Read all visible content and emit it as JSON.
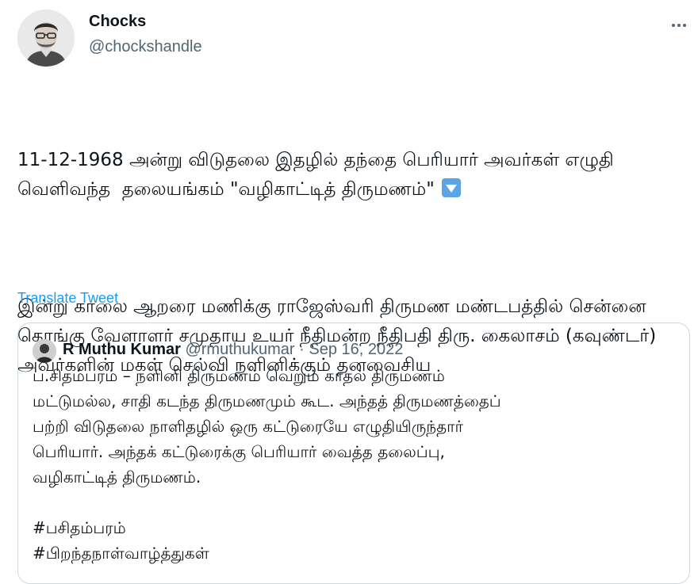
{
  "author": {
    "name": "Chocks",
    "handle": "@chockshandle",
    "avatar_icon": "person-portrait-icon"
  },
  "tweet": {
    "line1": "11-12-1968 அன்று விடுதலை இதழில் தந்தை பெரியார் அவர்கள் எழுதி வெளிவந்த  தலையங்கம் \"வழிகாட்டித் திருமணம்\"",
    "emoji": "down-arrow-button-icon",
    "para2": "இன்று காலை ஆறரை மணிக்கு ராஜேஸ்வரி திருமண மண்டபத்தில் சென்னை கொங்கு வேளாளர் சமுதாய உயர் நீதிமன்ற நீதிபதி திரு. கைலாசம் (கவுண்டர்) அவர்களின் மகள் செல்வி நளினிக்கும் தனவைசிய"
  },
  "translate_label": "Translate Tweet",
  "more_icon": "ellipsis-icon",
  "quote": {
    "name": "R Muthu Kumar",
    "handle": "@rmuthukumar",
    "separator": "·",
    "date": "Sep 16, 2022",
    "lines": [
      "ப.சிதம்பரம் – நளினி திருமணம் வெறும் காதல் திருமணம்",
      "மட்டுமல்ல, சாதி கடந்த திருமணமும் கூட.  அந்தத் திருமணத்தைப்",
      "பற்றி விடுதலை நாளிதழில் ஒரு கட்டுரையே எழுதியிருந்தார்",
      "பெரியார். அந்தக் கட்டுரைக்கு பெரியார் வைத்த தலைப்பு,",
      "வழிகாட்டித் திருமணம்."
    ],
    "hashtags": [
      "#பசிதம்பரம்",
      "#பிறந்தநாள்வாழ்த்துகள்"
    ]
  },
  "colors": {
    "text": "#0f1419",
    "secondary": "#536471",
    "link": "#1d9bf0",
    "border": "#cfd9de"
  }
}
